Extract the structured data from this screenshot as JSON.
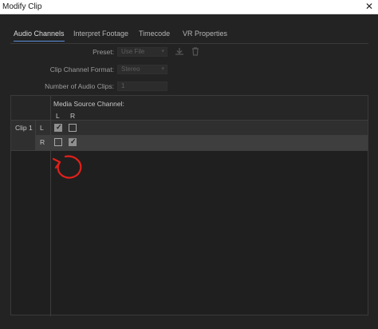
{
  "window": {
    "title": "Modify Clip",
    "close_glyph": "✕"
  },
  "tabs": [
    {
      "label": "Audio Channels",
      "active": true
    },
    {
      "label": "Interpret Footage",
      "active": false
    },
    {
      "label": "Timecode",
      "active": false
    },
    {
      "label": "VR Properties",
      "active": false
    }
  ],
  "form": {
    "preset_label": "Preset:",
    "preset_value": "Use File",
    "channel_format_label": "Clip Channel Format:",
    "channel_format_value": "Stereo",
    "num_clips_label": "Number of Audio Clips:",
    "num_clips_value": "1",
    "icons": [
      "download-icon",
      "trash-icon"
    ]
  },
  "grid": {
    "header": "Media Source Channel:",
    "columns": [
      "L",
      "R"
    ],
    "clip_label": "Clip 1",
    "rows": [
      {
        "channel": "L",
        "checks": [
          true,
          false
        ]
      },
      {
        "channel": "R",
        "checks": [
          false,
          true
        ]
      }
    ]
  },
  "annotation": {
    "color": "#e0201a",
    "shape": "hand-drawn-circular-arrow"
  },
  "colors": {
    "accent": "#5a8fd6",
    "background": "#232323"
  }
}
